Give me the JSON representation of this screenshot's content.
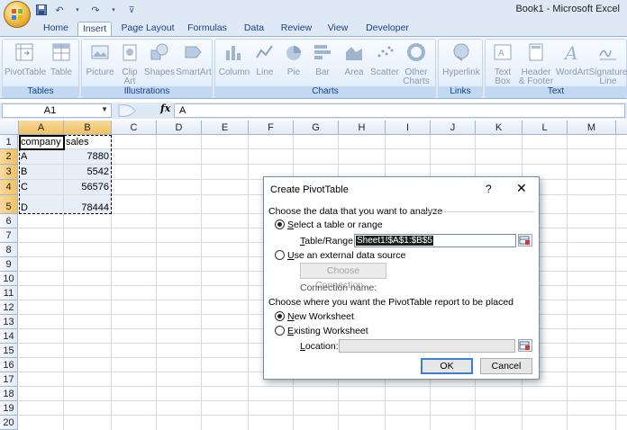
{
  "window": {
    "title": "Book1 - Microsoft Excel",
    "qat": [
      "save-icon",
      "undo-icon",
      "redo-icon",
      "customize-icon"
    ]
  },
  "tabs": [
    "Home",
    "Insert",
    "Page Layout",
    "Formulas",
    "Data",
    "Review",
    "View",
    "Developer"
  ],
  "active_tab": "Insert",
  "ribbon": {
    "groups": [
      {
        "label": "Tables",
        "buttons": [
          "PivotTable",
          "Table"
        ]
      },
      {
        "label": "Illustrations",
        "buttons": [
          "Picture",
          "Clip Art",
          "Shapes",
          "SmartArt"
        ]
      },
      {
        "label": "Charts",
        "buttons": [
          "Column",
          "Line",
          "Pie",
          "Bar",
          "Area",
          "Scatter",
          "Other Charts"
        ]
      },
      {
        "label": "Links",
        "buttons": [
          "Hyperlink"
        ]
      },
      {
        "label": "Text",
        "buttons": [
          "Text Box",
          "Header & Footer",
          "WordArt",
          "Signature Line"
        ]
      }
    ]
  },
  "formula_bar": {
    "name_box": "A1",
    "fx": "fx",
    "value": "A"
  },
  "sheet": {
    "columns": [
      "A",
      "B",
      "C",
      "D",
      "E",
      "F",
      "G",
      "H",
      "I",
      "J",
      "K",
      "L",
      "M"
    ],
    "rows": [
      "1",
      "2",
      "3",
      "4",
      "5",
      "6",
      "7",
      "8",
      "9",
      "10",
      "11",
      "12",
      "13",
      "14",
      "15",
      "16",
      "17",
      "18",
      "19",
      "20"
    ],
    "cells": {
      "A1": "company",
      "B1": "sales",
      "A2": "A",
      "B2": "7880",
      "A3": "B",
      "B3": "5542",
      "A4": "C",
      "B4": "56576",
      "A5": "D",
      "B5": "78444"
    }
  },
  "dialog": {
    "title": "Create PivotTable",
    "help": "?",
    "close": "✕",
    "section1": "Choose the data that you want to analyze",
    "opt_select": "Select a table or range",
    "range_label": "Table/Range:",
    "range_value": "Sheet1!$A$1:$B$5",
    "opt_external": "Use an external data source",
    "choose_connection": "Choose Connection...",
    "connection_name": "Connection name:",
    "section2": "Choose where you want the PivotTable report to be placed",
    "opt_new": "New Worksheet",
    "opt_existing": "Existing Worksheet",
    "location_label": "Location:",
    "location_value": "",
    "ok": "OK",
    "cancel": "Cancel",
    "selected_source": "select",
    "selected_place": "new"
  }
}
